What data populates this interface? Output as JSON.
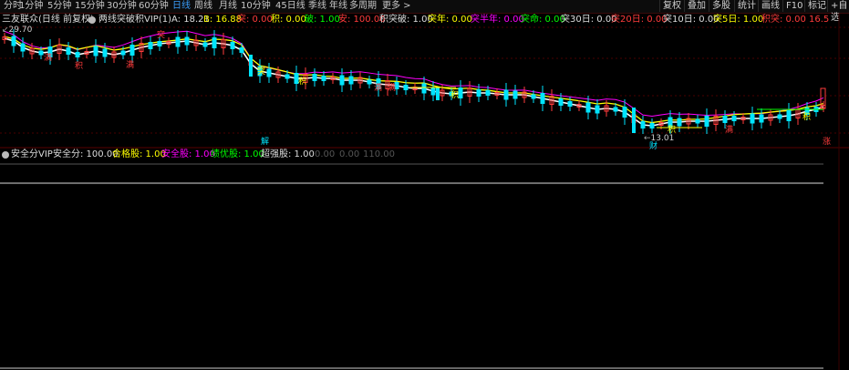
{
  "toolbar": {
    "periods": [
      "分时",
      "1分钟",
      "5分钟",
      "15分钟",
      "30分钟",
      "60分钟",
      "日线",
      "周线",
      "月线",
      "10分钟",
      "45日线",
      "季线",
      "年线",
      "多周期",
      "更多 >"
    ],
    "active": "日线",
    "right_buttons": [
      "复权",
      "叠加",
      "多股",
      "统计",
      "画线",
      "F10",
      "标记",
      "+自选"
    ]
  },
  "header": {
    "stock": "三友联众(日线 前复权)",
    "indicator": "两线突破积VIP(1)",
    "a_label": "A: 18.21",
    "b_label": "B: 16.88",
    "items": [
      {
        "text": "突: 0.00",
        "color": "#ff3b3b"
      },
      {
        "text": "积: 0.00",
        "color": "#ffff00"
      },
      {
        "text": "破: 1.00",
        "color": "#00ff00"
      },
      {
        "text": "安: 100.00",
        "color": "#ff3b3b"
      },
      {
        "text": "积突破: 1.00",
        "color": "#dddddd"
      },
      {
        "text": "突年: 0.00",
        "color": "#ffff00"
      },
      {
        "text": "突半年: 0.00",
        "color": "#ff00ff"
      },
      {
        "text": "突命: 0.00",
        "color": "#00ff00"
      },
      {
        "text": "突30日: 0.00",
        "color": "#dddddd"
      },
      {
        "text": "突20日: 0.00",
        "color": "#ff3b3b"
      },
      {
        "text": "突10日: 0.00",
        "color": "#dddddd"
      },
      {
        "text": "突5日: 1.00",
        "color": "#ffff00"
      },
      {
        "text": "积突: 0.00",
        "color": "#ff3b3b"
      },
      {
        "text": "16.5",
        "color": "#ff3b3b"
      }
    ]
  },
  "main_chart": {
    "price_high_label": "29.70",
    "price_low_label": "13.01",
    "signals": [
      "突",
      "积",
      "突",
      "满",
      "满",
      "积",
      "满",
      "满",
      "积",
      "积",
      "财",
      "积",
      "满",
      "解",
      "涨"
    ]
  },
  "sub_panel": {
    "indicator": "安全分VIP",
    "items": [
      {
        "text": "安全分: 100.00",
        "color": "#dddddd"
      },
      {
        "text": "合格股: 1.00",
        "color": "#ffff00"
      },
      {
        "text": "安全股: 1.00",
        "color": "#ff00ff"
      },
      {
        "text": "绩优股: 1.00",
        "color": "#00ff00"
      },
      {
        "text": "超强股: 1.00",
        "color": "#dddddd"
      },
      {
        "text": "0.00",
        "color": "#555555"
      },
      {
        "text": "0.00",
        "color": "#555555"
      },
      {
        "text": "110.00",
        "color": "#555555"
      }
    ]
  },
  "colors": {
    "up": "#ff3b3b",
    "down": "#00e5ff",
    "ma_white": "#ffffff",
    "ma_yellow": "#ffff00",
    "ma_magenta": "#ff00ff",
    "grid": "#4a0000"
  }
}
